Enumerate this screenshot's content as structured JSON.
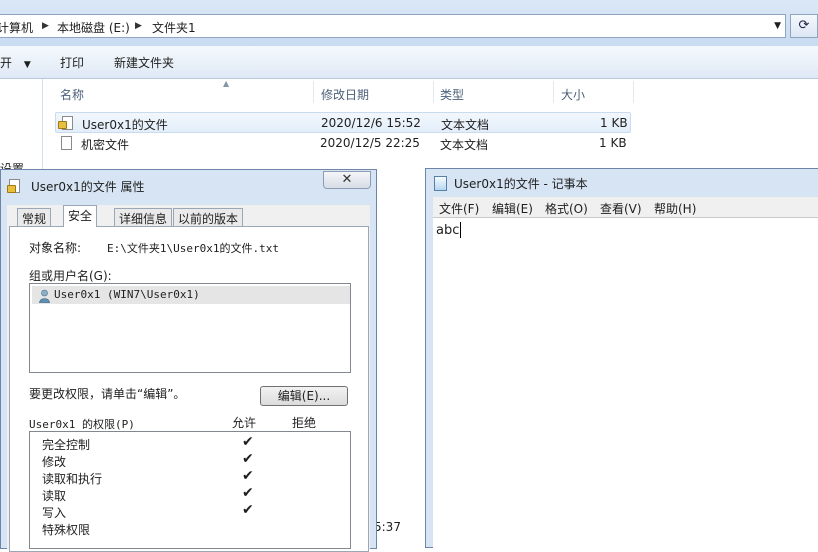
{
  "explorer": {
    "breadcrumbs": [
      "计算机",
      "本地磁盘 (E:)",
      "文件夹1"
    ],
    "toolbar": {
      "open_partial": "开",
      "print": "打印",
      "new_folder": "新建文件夹"
    },
    "nav_partial": "设置",
    "columns": [
      "名称",
      "修改日期",
      "类型",
      "大小"
    ],
    "files": [
      {
        "name": "User0x1的文件",
        "date": "2020/12/6 15:52",
        "type": "文本文档",
        "size": "1 KB",
        "locked": true
      },
      {
        "name": "机密文件",
        "date": "2020/12/5 22:25",
        "type": "文本文档",
        "size": "1 KB",
        "locked": false
      }
    ],
    "bottom_partial": "5:37"
  },
  "properties": {
    "title": "User0x1的文件 属性",
    "close_label": "✕",
    "tabs": [
      "常规",
      "安全",
      "详细信息",
      "以前的版本"
    ],
    "active_tab": "安全",
    "object_name_label": "对象名称:",
    "object_name_value": "E:\\文件夹1\\User0x1的文件.txt",
    "group_label": "组或用户名(G):",
    "users": [
      "User0x1 (WIN7\\User0x1)"
    ],
    "change_hint": "要更改权限，请单击“编辑”。",
    "edit_button": "编辑(E)...",
    "perm_label": "User0x1 的权限(P)",
    "allow_label": "允许",
    "deny_label": "拒绝",
    "permissions": [
      {
        "name": "完全控制",
        "allow": true
      },
      {
        "name": "修改",
        "allow": true
      },
      {
        "name": "读取和执行",
        "allow": true
      },
      {
        "name": "读取",
        "allow": true
      },
      {
        "name": "写入",
        "allow": true
      },
      {
        "name": "特殊权限",
        "allow": false
      }
    ],
    "check_glyph": "✔"
  },
  "notepad": {
    "title": "User0x1的文件 - 记事本",
    "menu": [
      "文件(F)",
      "编辑(E)",
      "格式(O)",
      "查看(V)",
      "帮助(H)"
    ],
    "content": "abc"
  },
  "icons": {
    "refresh": "refresh-icon",
    "user": "user-icon",
    "lock": "lock-icon"
  }
}
